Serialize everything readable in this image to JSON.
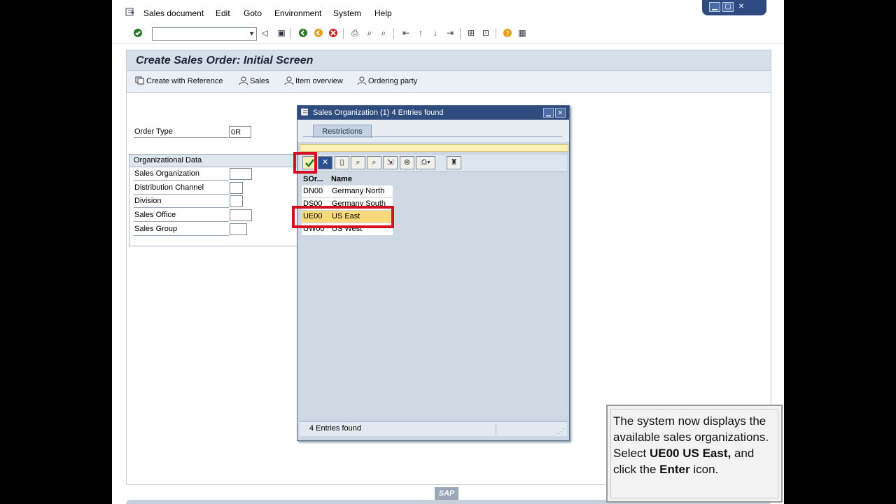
{
  "menubar": {
    "items": [
      "Sales document",
      "Edit",
      "Goto",
      "Environment",
      "System",
      "Help"
    ]
  },
  "main": {
    "title": "Create Sales Order: Initial Screen",
    "toolbar": {
      "buttons": [
        "Create with Reference",
        "Sales",
        "Item overview",
        "Ordering party"
      ]
    },
    "order_type": {
      "label": "Order Type",
      "value": "0R"
    },
    "org_data": {
      "header": "Organizational Data",
      "fields": [
        "Sales Organization",
        "Distribution Channel",
        "Division",
        "Sales Office",
        "Sales Group"
      ]
    }
  },
  "popup": {
    "title": "Sales Organization (1)   4 Entries found",
    "tab": "Restrictions",
    "columns": [
      "SOr...",
      "Name"
    ],
    "rows": [
      {
        "code": "DN00",
        "name": "Germany North"
      },
      {
        "code": "DS00",
        "name": "Germany South"
      },
      {
        "code": "UE00",
        "name": "US East"
      },
      {
        "code": "UW00",
        "name": "US West"
      }
    ],
    "status": "4 Entries found"
  },
  "footer": {
    "logo": "SAP"
  },
  "callout": {
    "line1": "The system now displays the available sales organizations. Select ",
    "bold1": "UE00 US East,",
    "line2": " and click the ",
    "bold2": "Enter",
    "line3": " icon."
  },
  "colors": {
    "highlight": "#d41020",
    "title_bar": "#2f4c7e",
    "selected_row": "#f9d97a"
  }
}
